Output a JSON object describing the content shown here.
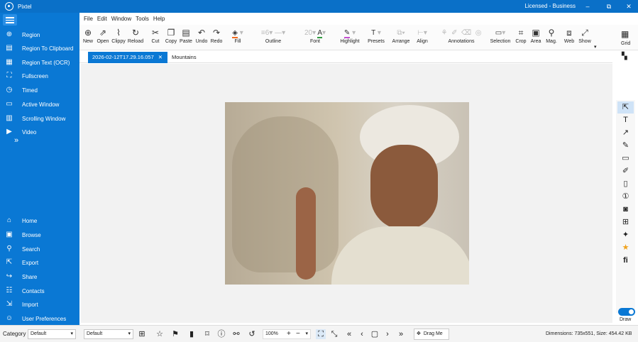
{
  "titlebar": {
    "app_title": "Pixtel",
    "license": "Licensed - Business",
    "minimize": "–",
    "maximize": "⧉",
    "close": "✕"
  },
  "sidebar": {
    "capture_items": [
      {
        "label": "Region",
        "icon": "region-icon"
      },
      {
        "label": "Region To Clipboard",
        "icon": "clipboard-icon"
      },
      {
        "label": "Region Text (OCR)",
        "icon": "ocr-icon"
      },
      {
        "label": "Fullscreen",
        "icon": "fullscreen-icon"
      },
      {
        "label": "Timed",
        "icon": "timer-icon"
      },
      {
        "label": "Active Window",
        "icon": "window-icon"
      },
      {
        "label": "Scrolling Window",
        "icon": "scroll-window-icon"
      },
      {
        "label": "Video",
        "icon": "video-icon"
      }
    ],
    "expand": "»",
    "nav_items": [
      {
        "label": "Home",
        "icon": "home-icon"
      },
      {
        "label": "Browse",
        "icon": "browse-icon"
      },
      {
        "label": "Search",
        "icon": "search-icon"
      },
      {
        "label": "Export",
        "icon": "export-icon"
      },
      {
        "label": "Share",
        "icon": "share-icon"
      },
      {
        "label": "Contacts",
        "icon": "contacts-icon"
      },
      {
        "label": "Import",
        "icon": "import-icon"
      },
      {
        "label": "User Preferences",
        "icon": "user-icon"
      }
    ]
  },
  "menubar": [
    "File",
    "Edit",
    "Window",
    "Tools",
    "Help"
  ],
  "ribbon": {
    "new": "New",
    "open": "Open",
    "clippy": "Clippy",
    "reload": "Reload",
    "cut": "Cut",
    "copy": "Copy",
    "paste": "Paste",
    "undo": "Undo",
    "redo": "Redo",
    "fill": "Fill",
    "outline": "Outline",
    "outline_width": "6",
    "font": "Font",
    "font_size": "20",
    "highlight": "Highlight",
    "presets": "Presets",
    "arrange": "Arrange",
    "align": "Align",
    "annotations": "Annotations",
    "selection": "Selection",
    "crop": "Crop",
    "area": "Area",
    "mag": "Mag.",
    "web": "Web",
    "show": "Show",
    "grid": "Grid",
    "fill_color": "#f26b1d",
    "font_color": "#2e9b3e",
    "highlight_color": "#c44fd0"
  },
  "tabs": [
    {
      "label": "2026-02-12T17.29.16.057",
      "close": "✕"
    },
    {
      "label": "Mountains"
    }
  ],
  "right_toolbar": {
    "draw": "Draw",
    "tools": [
      "pointer-icon",
      "text-icon",
      "arrow-icon",
      "pen-icon",
      "rectangle-icon",
      "marker-icon",
      "note-icon",
      "step-number-icon",
      "sticker-icon",
      "stamp-icon",
      "magic-icon",
      "star-icon",
      "text-style-icon"
    ]
  },
  "bottombar": {
    "category_label": "Category",
    "category_value": "Default",
    "style_value": "Default",
    "zoom": "100%",
    "drag": "Drag Me",
    "status": "Dimensions: 735x551, Size: 454.42 KB"
  }
}
